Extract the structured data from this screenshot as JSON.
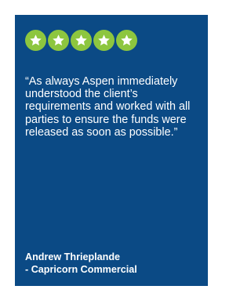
{
  "testimonial": {
    "rating": 5,
    "rating_max": 5,
    "star_icon": "star-icon",
    "quote": "“As always Aspen immediately understood the client’s requirements and worked with all parties to ensure the funds were released as soon as possible.”",
    "author_name": "Andrew Thrieplande",
    "author_company": "- Capricorn Commercial"
  },
  "colors": {
    "card_background": "#0b4a85",
    "star_badge": "#8dc63f",
    "text": "#ffffff"
  }
}
